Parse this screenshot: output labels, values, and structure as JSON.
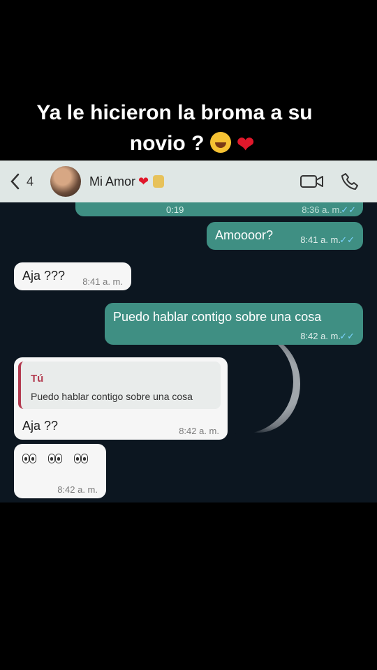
{
  "caption": {
    "line1": "Ya le hicieron la broma a su",
    "line2": "novio ?"
  },
  "header": {
    "back_count": "4",
    "contact_name": "Mi Amor",
    "icons": [
      "chevron-left-icon",
      "video-call-icon",
      "phone-icon"
    ]
  },
  "messages": [
    {
      "id": "top",
      "direction": "out",
      "duration": "0:19",
      "time": "8:36 a. m."
    },
    {
      "id": "m1",
      "direction": "out",
      "text": "Amoooor?",
      "time": "8:41 a. m."
    },
    {
      "id": "m2",
      "direction": "in",
      "text": "Aja ???",
      "time": "8:41 a. m."
    },
    {
      "id": "m3",
      "direction": "out",
      "text": "Puedo hablar contigo sobre una cosa",
      "time": "8:42 a. m."
    },
    {
      "id": "m4",
      "direction": "in",
      "reply_to": {
        "author": "Tú",
        "text": "Puedo hablar contigo sobre una cosa"
      },
      "text": "Aja ??",
      "time": "8:42 a. m."
    },
    {
      "id": "m5",
      "direction": "in",
      "text": "👀👀👀",
      "time": "8:42 a. m."
    }
  ],
  "colors": {
    "outgoing": "#3f8f83",
    "incoming": "#f6f6f6",
    "header_bg": "#dfe7e5",
    "chat_bg": "#0c1620"
  }
}
